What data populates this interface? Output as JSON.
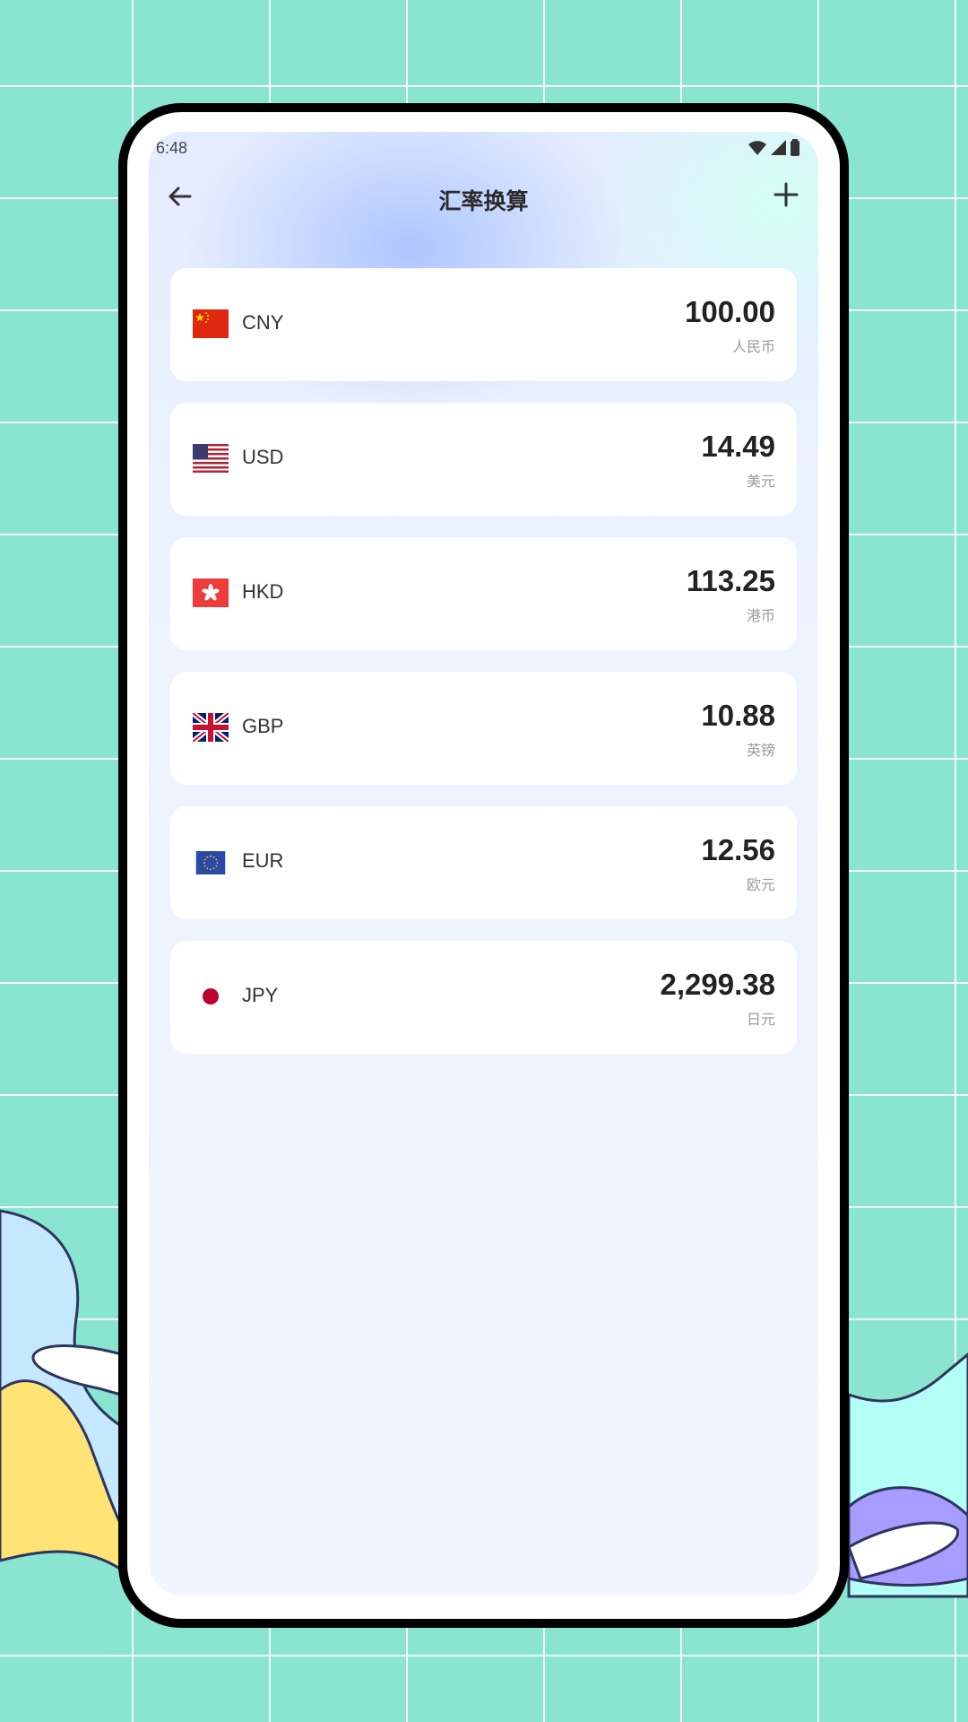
{
  "status_bar": {
    "time": "6:48"
  },
  "header": {
    "title": "汇率换算",
    "back_icon": "arrow-left-icon",
    "add_icon": "plus-icon"
  },
  "currencies": [
    {
      "code": "CNY",
      "amount": "100.00",
      "name": "人民币",
      "flag": "china-flag-icon"
    },
    {
      "code": "USD",
      "amount": "14.49",
      "name": "美元",
      "flag": "usa-flag-icon"
    },
    {
      "code": "HKD",
      "amount": "113.25",
      "name": "港币",
      "flag": "hong-kong-flag-icon"
    },
    {
      "code": "GBP",
      "amount": "10.88",
      "name": "英镑",
      "flag": "uk-flag-icon"
    },
    {
      "code": "EUR",
      "amount": "12.56",
      "name": "欧元",
      "flag": "eu-flag-icon"
    },
    {
      "code": "JPY",
      "amount": "2,299.38",
      "name": "日元",
      "flag": "japan-flag-icon"
    }
  ],
  "colors": {
    "background": "#89e4d0",
    "card": "#ffffff",
    "frame": "#000000"
  }
}
